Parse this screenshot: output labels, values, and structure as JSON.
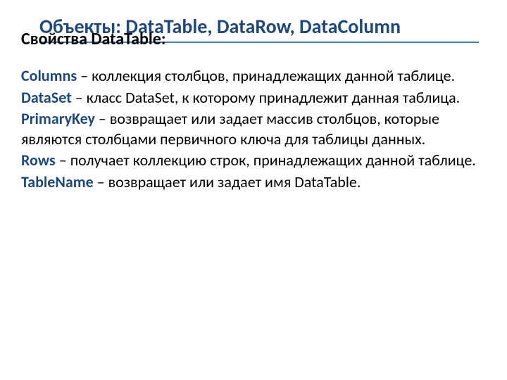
{
  "title": "Объекты: DataTable, DataRow, DataColumn",
  "subtitle": "Свойства DataTable:",
  "properties": [
    {
      "name": "Columns",
      "desc": " – коллекция столбцов, принадлежащих данной таблице."
    },
    {
      "name": "DataSet",
      "desc": " – класс DataSet, к которому принадлежит данная таблица."
    },
    {
      "name": "PrimaryKey",
      "desc": " – возвращает или задает массив столбцов, которые являются столбцами первичного ключа для таблицы данных."
    },
    {
      "name": "Rows",
      "desc": " – получает коллекцию строк, принадлежащих данной таблице."
    },
    {
      "name": "TableName",
      "desc": " – возвращает или задает имя DataTable."
    }
  ]
}
